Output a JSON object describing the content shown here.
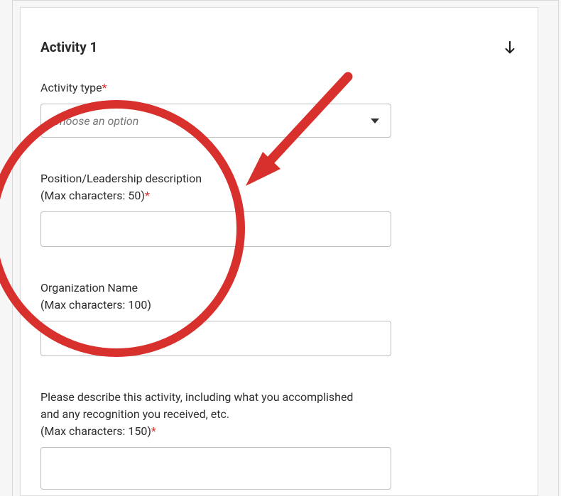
{
  "card": {
    "title": "Activity 1"
  },
  "fields": {
    "activity_type": {
      "label": "Activity type",
      "required_mark": "*",
      "placeholder": "Choose an option",
      "value": ""
    },
    "position_desc": {
      "label_line1": "Position/Leadership description",
      "label_line2": "(Max characters: 50)",
      "required_mark": "*",
      "value": ""
    },
    "org_name": {
      "label_line1": "Organization Name",
      "label_line2": "(Max characters: 100)",
      "value": ""
    },
    "describe": {
      "label_line1": "Please describe this activity, including what you accomplished",
      "label_line2": "and any recognition you received, etc.",
      "label_line3": "(Max characters: 150)",
      "required_mark": "*",
      "value": ""
    }
  }
}
